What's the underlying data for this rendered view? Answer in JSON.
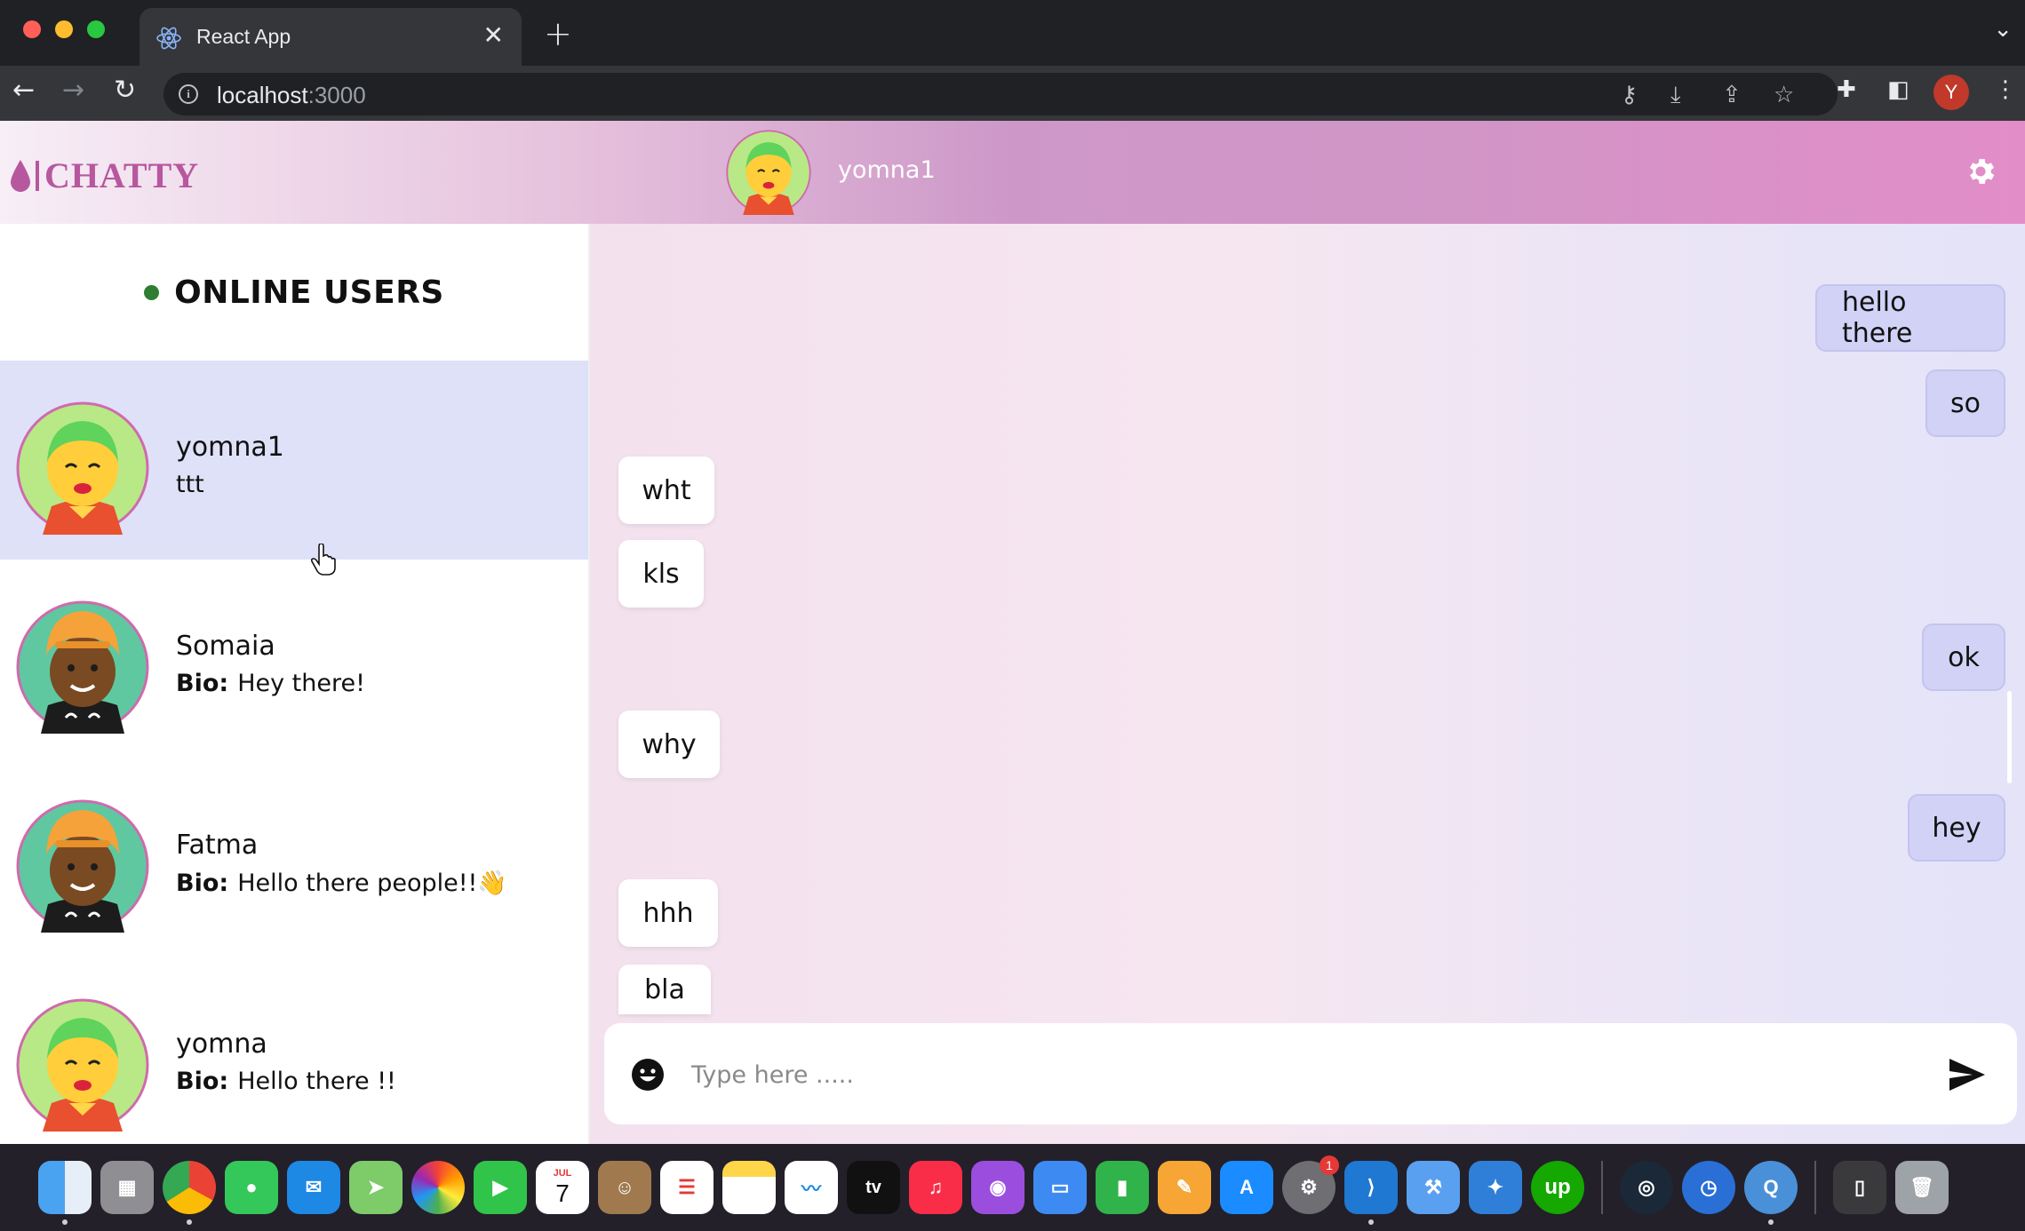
{
  "browser": {
    "tab_title": "React App",
    "tab_close": "✕",
    "new_tab": "+",
    "dropdown": "⌄",
    "url_host": "localhost",
    "url_port": ":3000",
    "profile_initial": "Y"
  },
  "app": {
    "logo_text": "CHATTY",
    "current_user": "yomna1",
    "brand_color": "#b7589f"
  },
  "sidebar": {
    "title": "ONLINE USERS",
    "users": [
      {
        "name": "yomna1",
        "subtitle": "ttt",
        "bio_label": "",
        "avatar": "green-girl-avatar",
        "active": true
      },
      {
        "name": "Somaia",
        "subtitle": "Hey there!",
        "bio_label": "Bio:",
        "avatar": "orange-hat-avatar",
        "active": false
      },
      {
        "name": "Fatma",
        "subtitle": "Hello there people!!👋",
        "bio_label": "Bio:",
        "avatar": "orange-hat-avatar",
        "active": false
      },
      {
        "name": "yomna",
        "subtitle": "Hello there !!",
        "bio_label": "Bio:",
        "avatar": "green-girl-avatar",
        "active": false
      }
    ]
  },
  "messages": [
    {
      "text": "hello there",
      "direction": "out"
    },
    {
      "text": "so",
      "direction": "out"
    },
    {
      "text": "wht",
      "direction": "in"
    },
    {
      "text": "kls",
      "direction": "in"
    },
    {
      "text": "ok",
      "direction": "out"
    },
    {
      "text": "why",
      "direction": "in"
    },
    {
      "text": "hey",
      "direction": "out"
    },
    {
      "text": "hhh",
      "direction": "in"
    },
    {
      "text": "bla",
      "direction": "in"
    }
  ],
  "composer": {
    "placeholder": "Type here ....."
  },
  "dock": {
    "calendar_month": "JUL",
    "calendar_day": "7",
    "settings_badge": "1",
    "tv_label": "tv",
    "upwork_label": "up"
  }
}
